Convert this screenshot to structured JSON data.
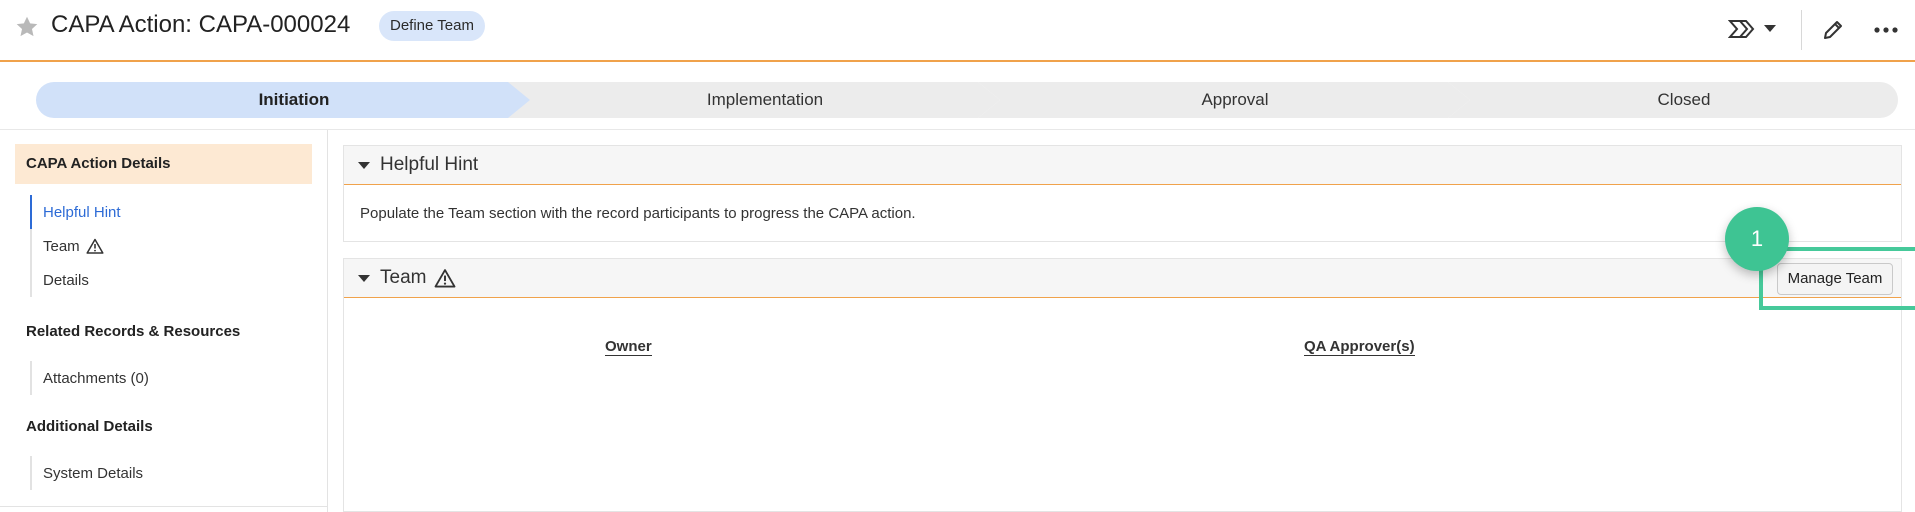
{
  "header": {
    "title": "CAPA Action: CAPA-000024",
    "status_badge": "Define Team",
    "icons": {
      "favorite": "star-icon",
      "workflow": "workflow-icon",
      "dropdown": "caret-down-icon",
      "edit": "pencil-icon",
      "more": "more-icon"
    }
  },
  "stages": [
    {
      "label": "Initiation",
      "active": true
    },
    {
      "label": "Implementation",
      "active": false
    },
    {
      "label": "Approval",
      "active": false
    },
    {
      "label": "Closed",
      "active": false
    }
  ],
  "sidebar": {
    "active_section": "CAPA Action Details",
    "section_items": [
      {
        "label": "Helpful Hint",
        "active": true
      },
      {
        "label": "Team",
        "warning": true
      },
      {
        "label": "Details"
      }
    ],
    "related_heading": "Related Records & Resources",
    "related_items": [
      {
        "label": "Attachments (0)"
      }
    ],
    "additional_heading": "Additional Details",
    "additional_items": [
      {
        "label": "System Details"
      }
    ]
  },
  "main": {
    "hint_section": {
      "title": "Helpful Hint",
      "text": "Populate the Team section with the record participants to progress the CAPA action."
    },
    "team_section": {
      "title": "Team",
      "manage_button": "Manage Team",
      "columns": [
        "Owner",
        "QA Approver(s)"
      ]
    }
  },
  "annotation": {
    "step_number": "1",
    "color": "#46c99a"
  },
  "colors": {
    "accent_orange": "#f0a24b",
    "active_stage": "#d1e1f9",
    "active_link": "#2d6bd6",
    "active_section_bg": "#fde9d3"
  }
}
